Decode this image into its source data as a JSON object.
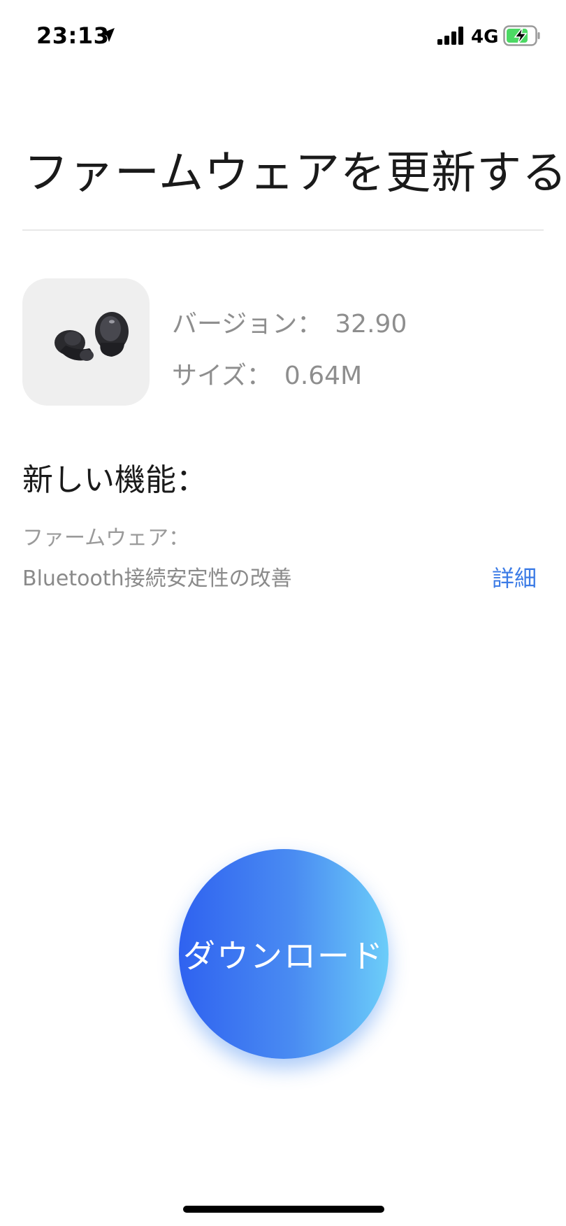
{
  "status_bar": {
    "time": "23:13",
    "network": "4G",
    "icons": [
      "location-arrow-icon",
      "cellular-signal-icon",
      "battery-charging-icon"
    ]
  },
  "header": {
    "title": "ファームウェアを更新する"
  },
  "product": {
    "image_icon": "earbuds-image",
    "version_label": "バージョン：",
    "version_value": "32.90",
    "size_label": "サイズ：",
    "size_value": "0.64M"
  },
  "features": {
    "heading": "新しい機能：",
    "category": "ファームウェア：",
    "item": "Bluetooth接続安定性の改善",
    "details_label": "詳細"
  },
  "download": {
    "label": "ダウンロード"
  },
  "colors": {
    "accent_link": "#3b7be6",
    "button_gradient_start": "#2f62f0",
    "button_gradient_end": "#6ccdf9",
    "battery_fill": "#4cd964"
  }
}
